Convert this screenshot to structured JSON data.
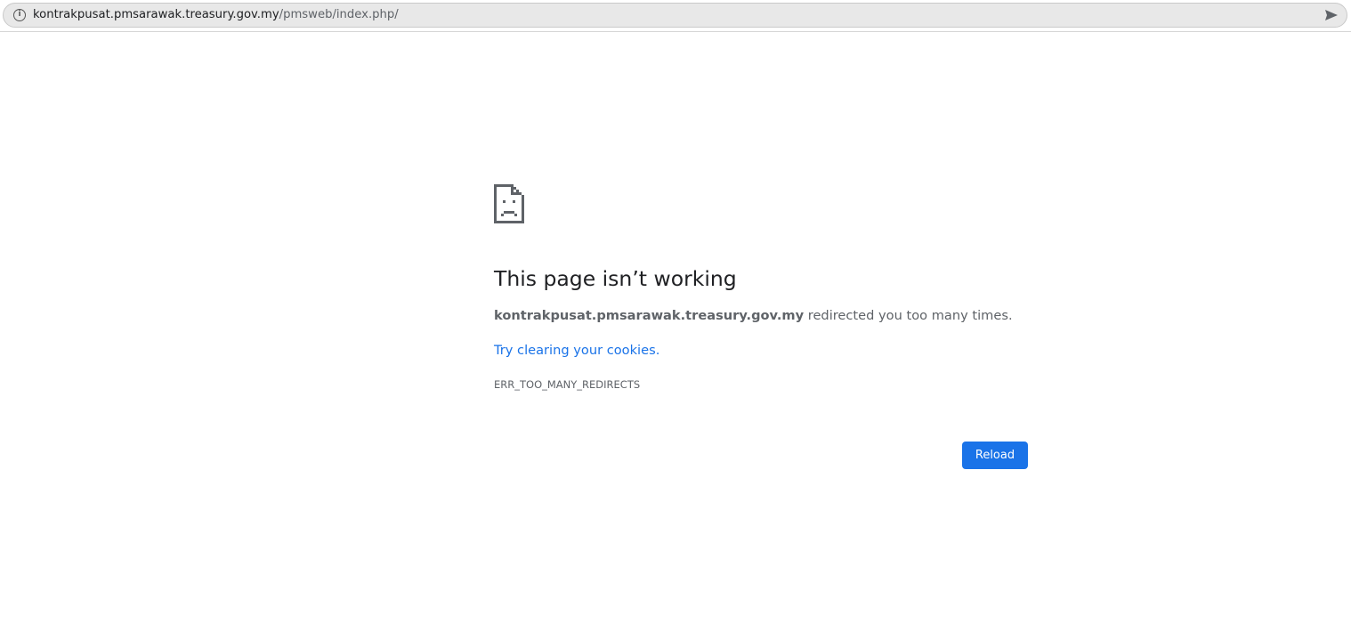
{
  "browser": {
    "url_host": "kontrakpusat.pmsarawak.treasury.gov.my",
    "url_path": "/pmsweb/index.php/",
    "info_icon": "info-icon",
    "go_icon": "send-arrow-icon"
  },
  "error_page": {
    "icon": "sad-page-icon",
    "heading": "This page isn’t working",
    "summary_host": "kontrakpusat.pmsarawak.treasury.gov.my",
    "summary_text": " redirected you too many times.",
    "suggestion_link": "Try clearing your cookies",
    "suggestion_suffix": ".",
    "error_code": "ERR_TOO_MANY_REDIRECTS",
    "reload_label": "Reload"
  },
  "colors": {
    "accent": "#1a73e8",
    "text_primary": "#202124",
    "text_secondary": "#5f6368",
    "omnibox_bg": "#e8e8e8"
  }
}
